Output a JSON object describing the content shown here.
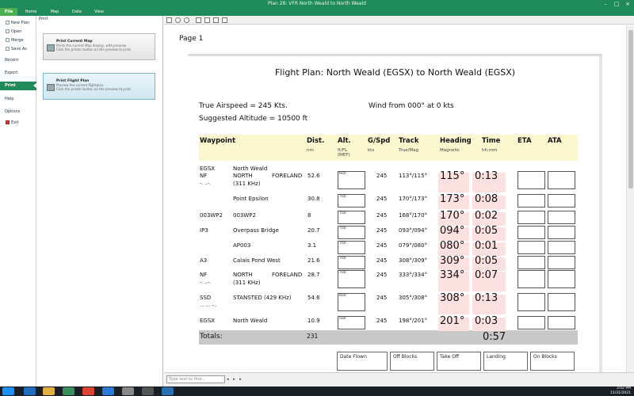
{
  "window": {
    "title": "Plan 28: VFR North Weald to North Weald"
  },
  "ribbon": {
    "tabs": [
      "File",
      "Home",
      "Map",
      "Data",
      "View"
    ]
  },
  "sidebar": {
    "items": [
      "New Plan",
      "Open",
      "Merge",
      "Save As",
      "Recent",
      "Export",
      "Print",
      "Help",
      "Options",
      "Exit"
    ]
  },
  "print_panel": {
    "heading": "Print",
    "current_map": {
      "title": "Print Current Map",
      "desc1": "Prints the current Map display, with preview.",
      "desc2": "Click the printer button on the preview to print."
    },
    "flight_plan": {
      "title": "Print Flight Plan",
      "desc1": "Preview the current flightplan.",
      "desc2": "Click the printer button on the preview to print."
    }
  },
  "preview": {
    "page_label": "Page 1",
    "find_placeholder": "Type text to find...",
    "find_nav": "◂ ▸ ▸"
  },
  "plan": {
    "title": "Flight Plan: North Weald (EGSX) to North Weald (EGSX)",
    "true_airspeed": "True Airspeed = 245 Kts.",
    "suggested_altitude": "Suggested Altitude = 10500 ft",
    "wind": "Wind from 000° at 0 kts",
    "headers": {
      "waypoint": "Waypoint",
      "dist": "Dist.",
      "dist_sub": "nm",
      "alt": "Alt.",
      "alt_sub1": "ft/FL",
      "alt_sub2": "(MEF)",
      "gspd": "G/Spd",
      "gspd_sub": "kts",
      "track": "Track",
      "track_sub": "True/Mag",
      "heading": "Heading",
      "heading_sub": "Magnetic",
      "time": "Time",
      "time_sub": "hh:mm",
      "eta": "ETA",
      "ata": "ATA"
    },
    "origin": {
      "id": "EGSX",
      "name": "North Weald"
    },
    "rows": [
      {
        "id": "NF",
        "morse": "-. ..-.",
        "name1": "NORTH",
        "name2": "FORELAND",
        "name3": "(311 KHz)",
        "dist": "52.6",
        "alt": "600",
        "gspd": "245",
        "track": "113°/115°",
        "heading": "115°",
        "time": "0:13"
      },
      {
        "id": "",
        "morse": "",
        "name1": "Point Epsilon",
        "name2": "",
        "name3": "",
        "dist": "30.8",
        "alt": "700",
        "gspd": "245",
        "track": "170°/173°",
        "heading": "173°",
        "time": "0:08"
      },
      {
        "id": "003WP2",
        "morse": "",
        "name1": "003WP2",
        "name2": "",
        "name3": "",
        "dist": "8",
        "alt": "700",
        "gspd": "245",
        "track": "168°/170°",
        "heading": "170°",
        "time": "0:02"
      },
      {
        "id": "IP3",
        "morse": "",
        "name1": "Overpass Bridge",
        "name2": "",
        "name3": "",
        "dist": "20.7",
        "alt": "700",
        "gspd": "245",
        "track": "093°/094°",
        "heading": "094°",
        "time": "0:05"
      },
      {
        "id": "",
        "morse": "",
        "name1": "AP003",
        "name2": "",
        "name3": "",
        "dist": "3.1",
        "alt": "700",
        "gspd": "245",
        "track": "079°/080°",
        "heading": "080°",
        "time": "0:01"
      },
      {
        "id": "A3",
        "morse": "",
        "name1": "Calais Pond West",
        "name2": "",
        "name3": "",
        "dist": "21.6",
        "alt": "700",
        "gspd": "245",
        "track": "308°/309°",
        "heading": "309°",
        "time": "0:05"
      },
      {
        "id": "NF",
        "morse": "-. ..-.",
        "name1": "NORTH",
        "name2": "FORELAND",
        "name3": "(311 KHz)",
        "dist": "28.7",
        "alt": "700",
        "gspd": "245",
        "track": "333°/334°",
        "heading": "334°",
        "time": "0:07"
      },
      {
        "id": "SSD",
        "morse": "... ... -..",
        "name1": "STANSTED (429 KHz)",
        "name2": "",
        "name3": "",
        "dist": "54.6",
        "alt": "600",
        "gspd": "245",
        "track": "305°/308°",
        "heading": "308°",
        "time": "0:13"
      },
      {
        "id": "EGSX",
        "morse": "",
        "name1": "North Weald",
        "name2": "",
        "name3": "",
        "dist": "10.9",
        "alt": "500",
        "gspd": "245",
        "track": "198°/201°",
        "heading": "201°",
        "time": "0:03"
      }
    ],
    "totals": {
      "label": "Totals:",
      "dist": "231",
      "time": "0:57"
    },
    "footer_boxes": [
      "Date Flown",
      "Off Blocks",
      "Take Off",
      "Landing",
      "On Blocks"
    ]
  },
  "taskbar": {
    "time": "3:02 PM",
    "date": "11/31/2021"
  }
}
